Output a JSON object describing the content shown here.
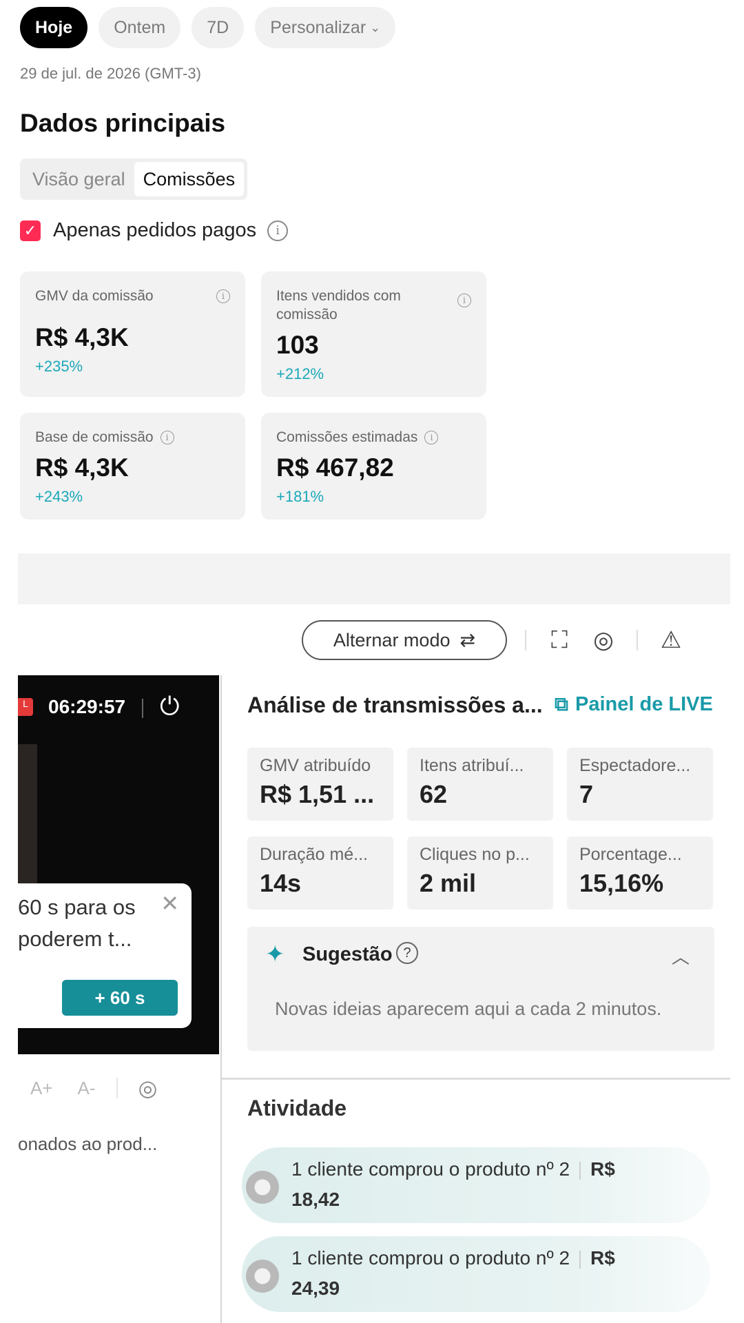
{
  "filters": {
    "chips": [
      {
        "label": "Hoje",
        "active": true
      },
      {
        "label": "Ontem",
        "active": false
      },
      {
        "label": "7D",
        "active": false
      },
      {
        "label": "Personalizar",
        "active": false
      }
    ],
    "date": "29 de jul. de 2026 (GMT-3)"
  },
  "main": {
    "title": "Dados principais",
    "tabs": [
      {
        "label": "Visão geral",
        "active": false
      },
      {
        "label": "Comissões",
        "active": true
      }
    ],
    "paid_only": {
      "label": "Apenas pedidos pagos",
      "checked": true
    },
    "cards": [
      {
        "label": "GMV da comissão",
        "value": "R$ 4,3K",
        "delta": "+235%"
      },
      {
        "label": "Itens vendidos com comissão",
        "value": "103",
        "delta": "+212%"
      },
      {
        "label": "Base de comissão",
        "value": "R$ 4,3K",
        "delta": "+243%"
      },
      {
        "label": "Comissões estimadas",
        "value": "R$ 467,82",
        "delta": "+181%"
      }
    ]
  },
  "live": {
    "toolbar": {
      "mode_button": "Alternar modo"
    },
    "timer": "06:29:57",
    "popup": {
      "text": "60 s para os poderem t...",
      "button": "+ 60 s"
    },
    "font_controls": {
      "increase": "A+",
      "decrease": "A-"
    },
    "truncated_text": "onados ao prod...",
    "analysis": {
      "title": "Análise de transmissões a...",
      "link": "Painel de LIVE",
      "metrics": [
        {
          "label": "GMV atribuído",
          "value": "R$ 1,51 ..."
        },
        {
          "label": "Itens atribuí...",
          "value": "62"
        },
        {
          "label": "Espectadore...",
          "value": "7"
        },
        {
          "label": "Duração mé...",
          "value": "14s"
        },
        {
          "label": "Cliques no p...",
          "value": "2 mil"
        },
        {
          "label": "Porcentage...",
          "value": "15,16%"
        }
      ]
    },
    "suggestion": {
      "title": "Sugestão",
      "text": "Novas ideias aparecem aqui a cada 2 minutos."
    },
    "activity": {
      "title": "Atividade",
      "items": [
        {
          "text": "1 cliente comprou o produto nº 2",
          "currency": "R$",
          "amount": "18,42"
        },
        {
          "text": "1 cliente comprou o produto nº 2",
          "currency": "R$",
          "amount": "24,39"
        }
      ]
    }
  },
  "colors": {
    "accent": "#fe2c55",
    "positive": "#1aa8b8",
    "teal_button": "#168f99"
  }
}
